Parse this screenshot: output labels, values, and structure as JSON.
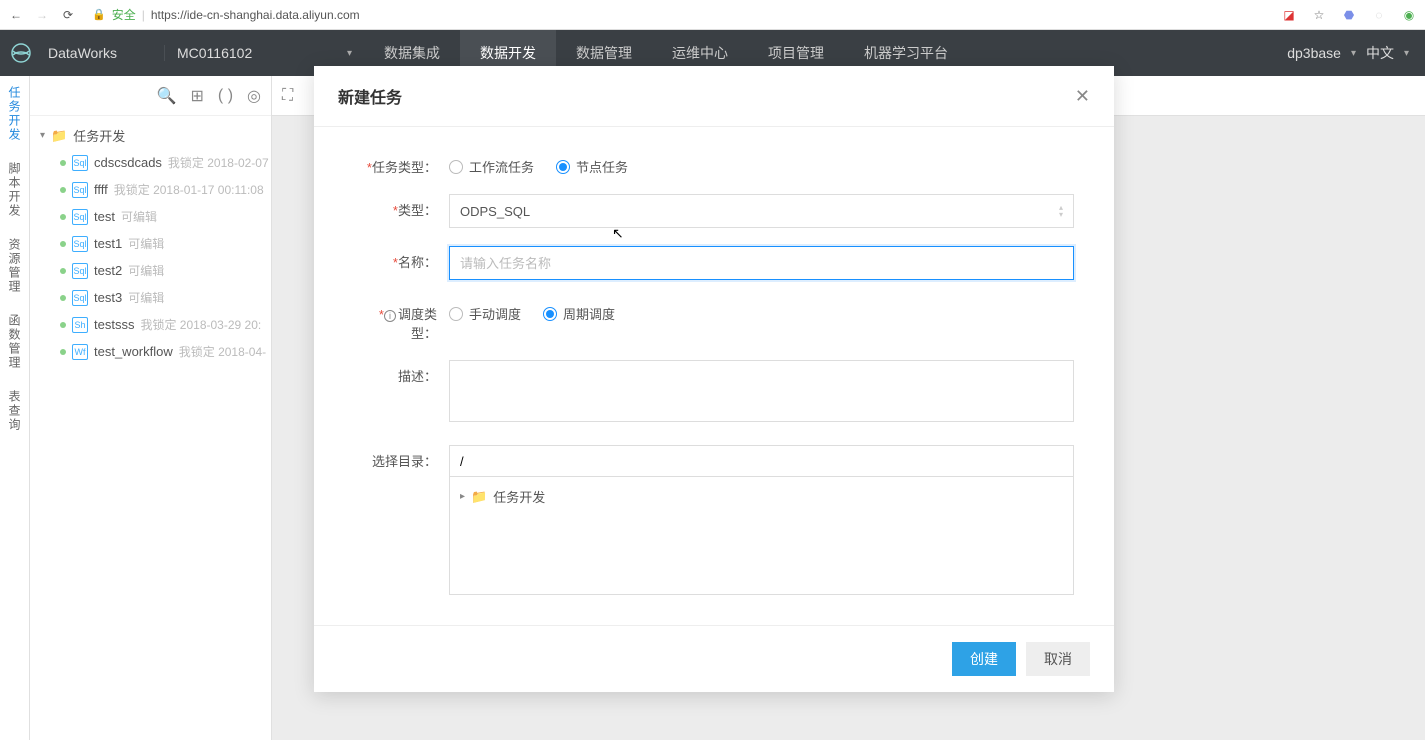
{
  "browser": {
    "secure_label": "安全",
    "url": "https://ide-cn-shanghai.data.aliyun.com"
  },
  "header": {
    "brand": "DataWorks",
    "project": "MC0116102",
    "nav": [
      "数据集成",
      "数据开发",
      "数据管理",
      "运维中心",
      "项目管理",
      "机器学习平台"
    ],
    "active_nav": 1,
    "user": "dp3base",
    "lang": "中文"
  },
  "rail": [
    "任务开发",
    "脚本开发",
    "资源管理",
    "函数管理",
    "表查询"
  ],
  "tree": {
    "root": "任务开发",
    "items": [
      {
        "icon": "Sql",
        "name": "cdscsdcads",
        "meta": "我锁定 2018-02-07"
      },
      {
        "icon": "Sql",
        "name": "ffff",
        "meta": "我锁定 2018-01-17 00:11:08"
      },
      {
        "icon": "Sql",
        "name": "test",
        "meta": "可编辑"
      },
      {
        "icon": "Sql",
        "name": "test1",
        "meta": "可编辑"
      },
      {
        "icon": "Sql",
        "name": "test2",
        "meta": "可编辑"
      },
      {
        "icon": "Sql",
        "name": "test3",
        "meta": "可编辑"
      },
      {
        "icon": "Sh",
        "name": "testsss",
        "meta": "我锁定 2018-03-29 20:"
      },
      {
        "icon": "Wf",
        "name": "test_workflow",
        "meta": "我锁定 2018-04-"
      }
    ]
  },
  "modal": {
    "title": "新建任务",
    "labels": {
      "task_type": "任务类型：",
      "type": "类型：",
      "name": "名称：",
      "schedule_type": "调度类型：",
      "description": "描述：",
      "select_dir": "选择目录："
    },
    "task_type_options": [
      "工作流任务",
      "节点任务"
    ],
    "task_type_selected": 1,
    "type_value": "ODPS_SQL",
    "name_placeholder": "请输入任务名称",
    "schedule_options": [
      "手动调度",
      "周期调度"
    ],
    "schedule_selected": 1,
    "dir_value": "/",
    "dir_tree_root": "任务开发",
    "buttons": {
      "create": "创建",
      "cancel": "取消"
    }
  }
}
